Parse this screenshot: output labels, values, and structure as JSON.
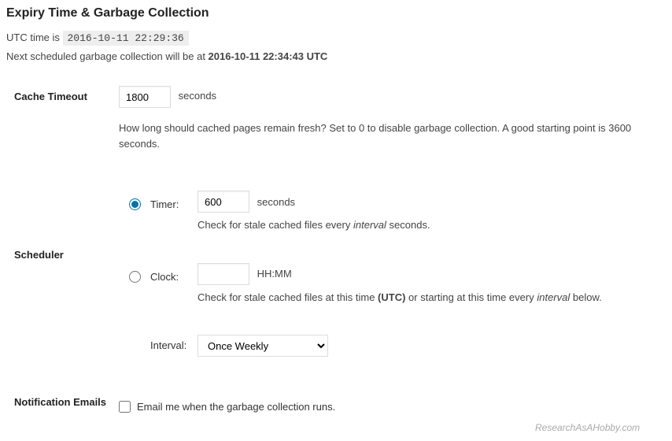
{
  "heading": "Expiry Time & Garbage Collection",
  "utc": {
    "prefix": "UTC time is ",
    "value": "2016-10-11 22:29:36"
  },
  "gc": {
    "prefix": "Next scheduled garbage collection will be at ",
    "value": "2016-10-11 22:34:43 UTC"
  },
  "cache_timeout": {
    "label": "Cache Timeout",
    "value": "1800",
    "unit": "seconds",
    "help": "How long should cached pages remain fresh? Set to 0 to disable garbage collection. A good starting point is 3600 seconds."
  },
  "scheduler": {
    "label": "Scheduler",
    "timer": {
      "label": "Timer:",
      "value": "600",
      "unit": "seconds",
      "help_before": "Check for stale cached files every ",
      "help_em": "interval",
      "help_after": " seconds."
    },
    "clock": {
      "label": "Clock:",
      "value": "",
      "unit": "HH:MM",
      "help_before": "Check for stale cached files at this time ",
      "help_bold": "(UTC)",
      "help_mid": " or starting at this time every ",
      "help_em": "interval",
      "help_after": " below."
    },
    "interval": {
      "label": "Interval:",
      "selected": "Once Weekly"
    }
  },
  "notification": {
    "label": "Notification Emails",
    "checkbox_label": "Email me when the garbage collection runs."
  },
  "watermark": "ResearchAsAHobby.com"
}
